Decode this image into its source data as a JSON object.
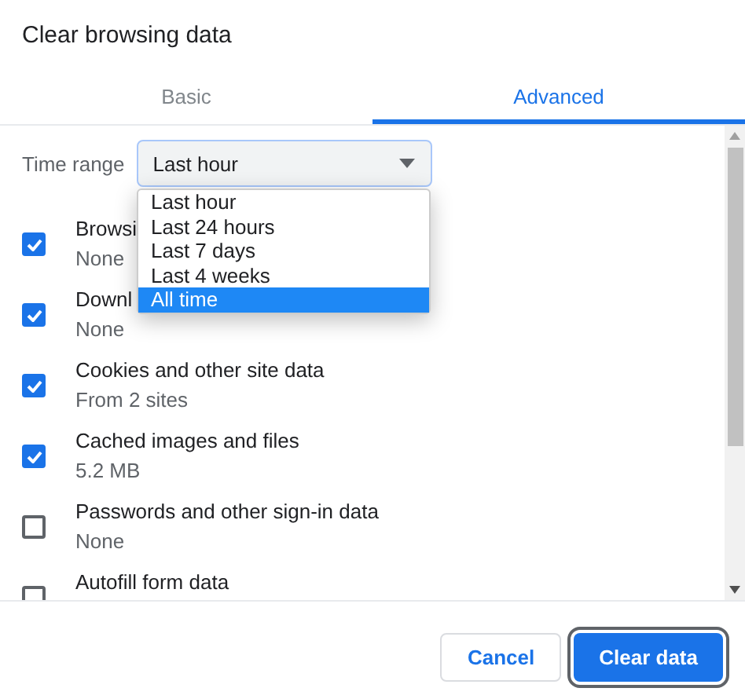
{
  "dialog": {
    "title": "Clear browsing data"
  },
  "tabs": [
    {
      "label": "Basic",
      "selected": false
    },
    {
      "label": "Advanced",
      "selected": true
    }
  ],
  "time_range": {
    "label": "Time range",
    "value": "Last hour",
    "open": true,
    "options": [
      {
        "label": "Last hour",
        "highlighted": false
      },
      {
        "label": "Last 24 hours",
        "highlighted": false
      },
      {
        "label": "Last 7 days",
        "highlighted": false
      },
      {
        "label": "Last 4 weeks",
        "highlighted": false
      },
      {
        "label": "All time",
        "highlighted": true
      }
    ]
  },
  "items": [
    {
      "label": "Browsi",
      "detail": "None",
      "checked": true
    },
    {
      "label": "Downl",
      "detail": "None",
      "checked": true
    },
    {
      "label": "Cookies and other site data",
      "detail": "From 2 sites",
      "checked": true
    },
    {
      "label": "Cached images and files",
      "detail": "5.2 MB",
      "checked": true
    },
    {
      "label": "Passwords and other sign-in data",
      "detail": "None",
      "checked": false
    },
    {
      "label": "Autofill form data",
      "checked": false
    }
  ],
  "buttons": [
    {
      "label": "Cancel",
      "kind": "secondary"
    },
    {
      "label": "Clear data",
      "kind": "primary"
    }
  ]
}
